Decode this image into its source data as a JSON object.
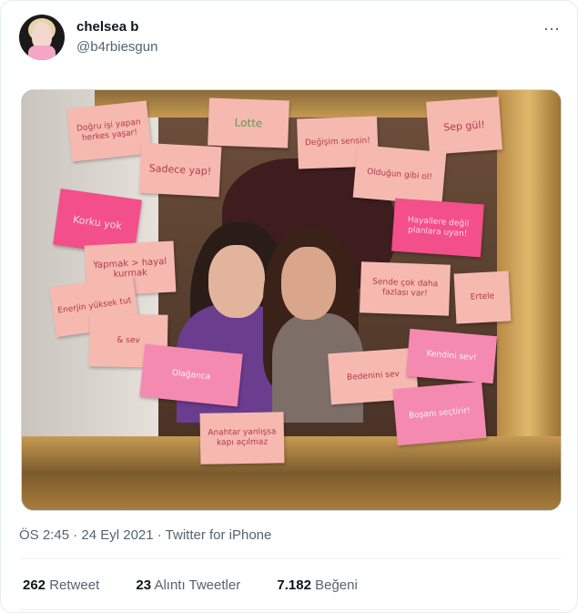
{
  "tweet": {
    "display_name": "chelsea b",
    "handle": "@b4rbiesgun",
    "more_icon": "⋯",
    "meta": "ÖS 2:45 · 24 Eyl 2021 · Twitter for iPhone",
    "retweets_count": "262",
    "retweets_label": "Retweet",
    "quotes_count": "23",
    "quotes_label": "Alıntı Tweetler",
    "likes_count": "7.182",
    "likes_label": "Beğeni"
  },
  "image": {
    "notes": [
      "Doğru işi yapan herkes yaşar!",
      "Lotte",
      "Değişim sensin!",
      "Sadece yap!",
      "Sep gül!",
      "Olduğun gibi ol!",
      "Korku yok",
      "Hayallere değil planlara uyan!",
      "Yapmak > hayal kurmak",
      "Enerjin yüksek tut",
      "Sende çok daha fazlası var!",
      "Ertele",
      "& sev",
      "Olağanca",
      "Bedenini sev",
      "Kendini sev!",
      "Boşanı seçtirir!",
      "Anahtar yanlışsa kapı açılmaz"
    ]
  }
}
